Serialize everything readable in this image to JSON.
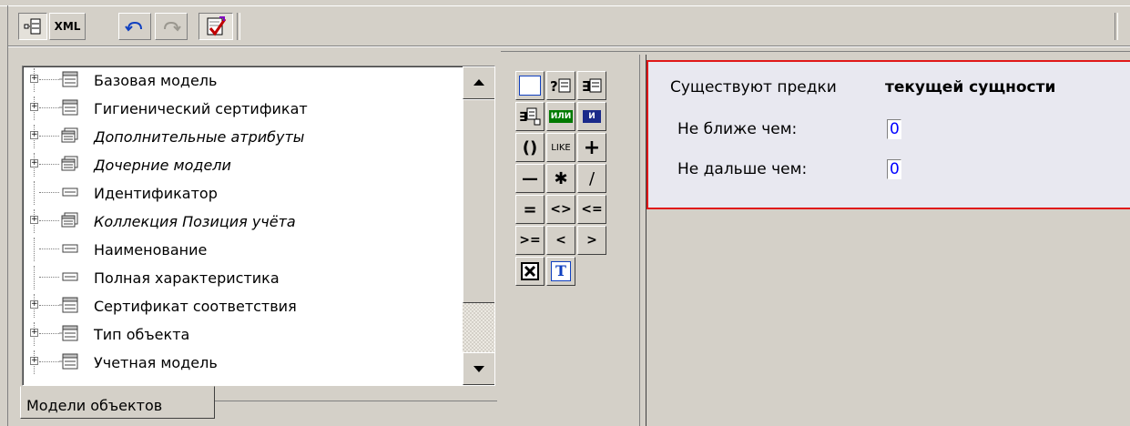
{
  "toolbar": {
    "tree_view_btn": "tree-view",
    "xml_label": "XML",
    "undo": "undo",
    "redo": "redo",
    "check": "check"
  },
  "tree": {
    "items": [
      {
        "label": "Базовая модель",
        "italic": false,
        "expandable": true,
        "icon": "model"
      },
      {
        "label": "Гигиенический сертификат",
        "italic": false,
        "expandable": true,
        "icon": "model"
      },
      {
        "label": "Дополнительные атрибуты",
        "italic": true,
        "expandable": true,
        "icon": "collection"
      },
      {
        "label": "Дочерние модели",
        "italic": true,
        "expandable": true,
        "icon": "collection"
      },
      {
        "label": "Идентификатор",
        "italic": false,
        "expandable": false,
        "icon": "field"
      },
      {
        "label": "Коллекция Позиция учёта",
        "italic": true,
        "expandable": true,
        "icon": "collection"
      },
      {
        "label": "Наименование",
        "italic": false,
        "expandable": false,
        "icon": "field"
      },
      {
        "label": "Полная характеристика",
        "italic": false,
        "expandable": false,
        "icon": "field"
      },
      {
        "label": "Сертификат соответствия",
        "italic": false,
        "expandable": true,
        "icon": "model"
      },
      {
        "label": "Тип объекта",
        "italic": false,
        "expandable": true,
        "icon": "model"
      },
      {
        "label": "Учетная модель",
        "italic": false,
        "expandable": true,
        "icon": "model"
      }
    ]
  },
  "tab": {
    "label": "Модели объектов"
  },
  "operators": {
    "or": "ИЛИ",
    "and": "И",
    "parens": "()",
    "like": "LIKE",
    "plus": "+",
    "minus": "—",
    "mult": "✱",
    "div": "/",
    "eq": "=",
    "ne": "<>",
    "le": "<=",
    "ge": ">=",
    "lt": "<",
    "gt": ">",
    "text": "T"
  },
  "condition": {
    "prefix": "Существуют предки",
    "bold": "текущей сущности",
    "min_label": "Не ближе чем:",
    "min_value": "0",
    "max_label": "Не дальше чем:",
    "max_value": "0"
  }
}
